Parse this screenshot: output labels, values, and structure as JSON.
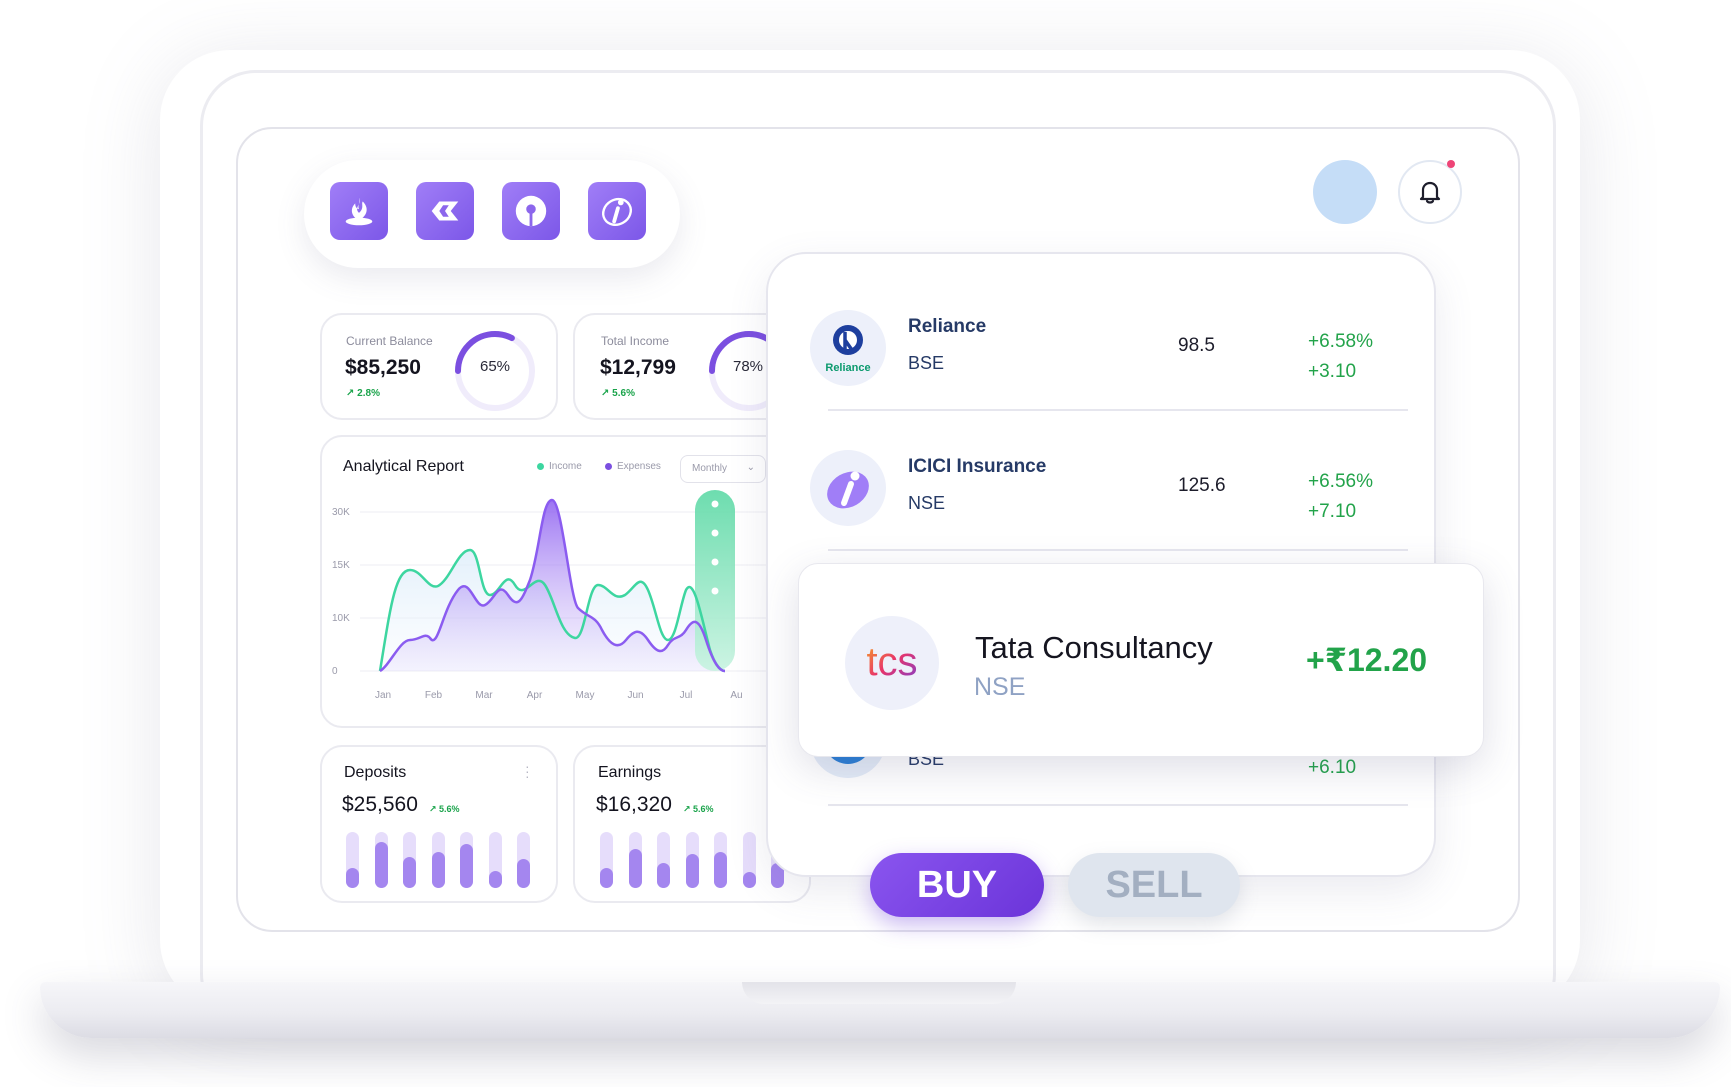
{
  "stats": [
    {
      "label": "Current Balance",
      "value": "$85,250",
      "change": "2.8%",
      "gauge_pct": "65%",
      "gauge_fraction": 0.65
    },
    {
      "label": "Total Income",
      "value": "$12,799",
      "change": "5.6%",
      "gauge_pct": "78%",
      "gauge_fraction": 0.78
    }
  ],
  "report": {
    "title": "Analytical Report",
    "legend": [
      {
        "name": "Income",
        "color": "#3dd6a0"
      },
      {
        "name": "Expenses",
        "color": "#7b4fe0"
      }
    ],
    "period": "Monthly",
    "y_ticks": [
      "30K",
      "15K",
      "10K",
      "0"
    ],
    "x_ticks": [
      "Jan",
      "Feb",
      "Mar",
      "Apr",
      "May",
      "Jun",
      "Jul",
      "Au"
    ]
  },
  "deposits": {
    "title": "Deposits",
    "value": "$25,560",
    "change": "5.6%",
    "bars": [
      0.35,
      0.82,
      0.55,
      0.65,
      0.78,
      0.3,
      0.52
    ]
  },
  "earnings": {
    "title": "Earnings",
    "value": "$16,320",
    "change": "5.6%",
    "bars": [
      0.35,
      0.7,
      0.45,
      0.6,
      0.65,
      0.28,
      0.45
    ]
  },
  "stocks": [
    {
      "name": "Reliance",
      "exchange": "BSE",
      "price": "98.5",
      "pct": "+6.58%",
      "abs": "+3.10",
      "logo_text": "Reliance"
    },
    {
      "name": "ICICI Insurance",
      "exchange": "NSE",
      "price": "125.6",
      "pct": "+6.56%",
      "abs": "+7.10"
    },
    {
      "exchange": "BSE",
      "abs": "+6.10"
    }
  ],
  "highlight": {
    "name": "Tata Consultancy",
    "exchange": "NSE",
    "change": "+₹12.20",
    "logo_text": "tcs"
  },
  "actions": {
    "buy": "BUY",
    "sell": "SELL"
  },
  "colors": {
    "accent": "#7b4fe0",
    "income": "#3dd6a0",
    "positive": "#22a34a"
  }
}
